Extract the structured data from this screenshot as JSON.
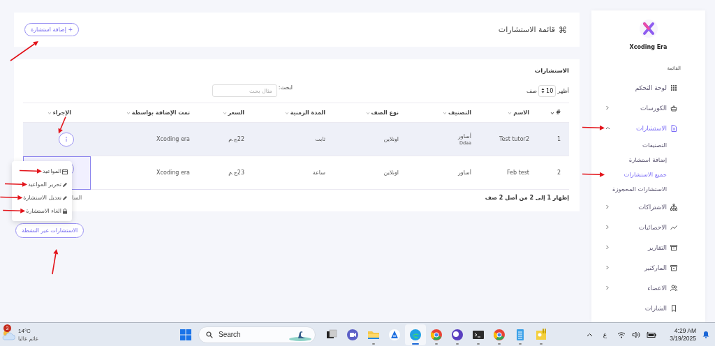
{
  "sidebar": {
    "brand": "Xcoding Era",
    "section_title": "القائمة",
    "items": [
      {
        "label": "لوحة التحكم",
        "selected": false,
        "annotated": false
      },
      {
        "label": "الكورسات",
        "selected": false,
        "expanded": false,
        "annotated": false
      },
      {
        "label": "الاستشارات",
        "selected": true,
        "expanded": true,
        "annotated": true,
        "children": [
          {
            "label": "التصنيفات",
            "selected": false,
            "annotated": false
          },
          {
            "label": "إضافة استشارة",
            "selected": false,
            "annotated": false
          },
          {
            "label": "جميع الاستشارات",
            "selected": true,
            "annotated": true
          },
          {
            "label": "الاستشارات المحجوزة",
            "selected": false,
            "annotated": false
          }
        ]
      },
      {
        "label": "الاشتراكات",
        "selected": false,
        "expanded": false,
        "annotated": false
      },
      {
        "label": "الاحصائيات",
        "selected": false,
        "expanded": false,
        "annotated": false
      },
      {
        "label": "التقارير",
        "selected": false,
        "expanded": false,
        "annotated": false
      },
      {
        "label": "الماركتير",
        "selected": false,
        "expanded": false,
        "annotated": false
      },
      {
        "label": "الاعضاء",
        "selected": false,
        "expanded": false,
        "annotated": false
      },
      {
        "label": "الشارات",
        "selected": false,
        "annotated": false
      }
    ]
  },
  "header": {
    "title_icon": "⌘",
    "title": "قائمة الاستشارات",
    "add_button": {
      "label": "+ إضافة استشارة",
      "annotated": true
    }
  },
  "table_card": {
    "title": "الاستشارات",
    "length": {
      "before": "أظهر",
      "value": "10",
      "after": "صف"
    },
    "search": {
      "label": "ابحث:",
      "placeholder": "مثال بحث"
    },
    "columns": [
      {
        "label": "#",
        "sorted": true
      },
      {
        "label": "الاسم",
        "sorted": false
      },
      {
        "label": "التصنيف",
        "sorted": false
      },
      {
        "label": "نوع الصف",
        "sorted": false
      },
      {
        "label": "المدة الزمنية",
        "sorted": false
      },
      {
        "label": "السعر",
        "sorted": false
      },
      {
        "label": "تمت الإضافة بواسطة",
        "sorted": false
      },
      {
        "label": "الإجراء",
        "sorted": false
      }
    ],
    "rows": [
      {
        "index": "1",
        "name": "Test tutor2",
        "category": "أساور",
        "subcategory": "Ddaa",
        "type": "اونلاين",
        "duration": "ثابت",
        "price": "22ج.م",
        "added_by": "Xcoding era",
        "highlighted": true,
        "menu_open": false,
        "annotated": true
      },
      {
        "index": "2",
        "name": "Feb test",
        "category": "أساور",
        "type": "اونلاين",
        "duration": "ساعة",
        "price": "23ج.م",
        "added_by": "Xcoding era",
        "highlighted": false,
        "menu_open": true,
        "annotated": false
      }
    ],
    "info": "إظهار 1 إلى 2 من أصل 2 صف",
    "pagination_previous": "السا"
  },
  "action_menu": [
    {
      "label": "المواعيد",
      "annotated": true
    },
    {
      "label": "تحرير المواعيد",
      "annotated": true
    },
    {
      "label": "تعديل الاستشارة",
      "annotated": true
    },
    {
      "label": "الغاء الاستشارة",
      "annotated": true
    }
  ],
  "inactive_button": {
    "label": "الاستشارات غير النشطة",
    "annotated": true
  },
  "taskbar": {
    "weather": {
      "badge": "3",
      "temperature": "14°C",
      "condition": "غائم غالبا"
    },
    "search": {
      "placeholder": "Search"
    },
    "apps": [
      {
        "running": false,
        "active": false
      },
      {
        "running": false,
        "active": false
      },
      {
        "running": true,
        "active": false
      },
      {
        "running": false,
        "active": false
      },
      {
        "running": true,
        "active": true
      },
      {
        "running": true,
        "active": false
      },
      {
        "running": true,
        "active": false
      },
      {
        "running": true,
        "active": false
      },
      {
        "running": true,
        "active": false
      },
      {
        "running": true,
        "active": false
      },
      {
        "running": true,
        "active": false
      }
    ],
    "language": "ع",
    "time": "4:29 AM",
    "date": "3/19/2025"
  }
}
